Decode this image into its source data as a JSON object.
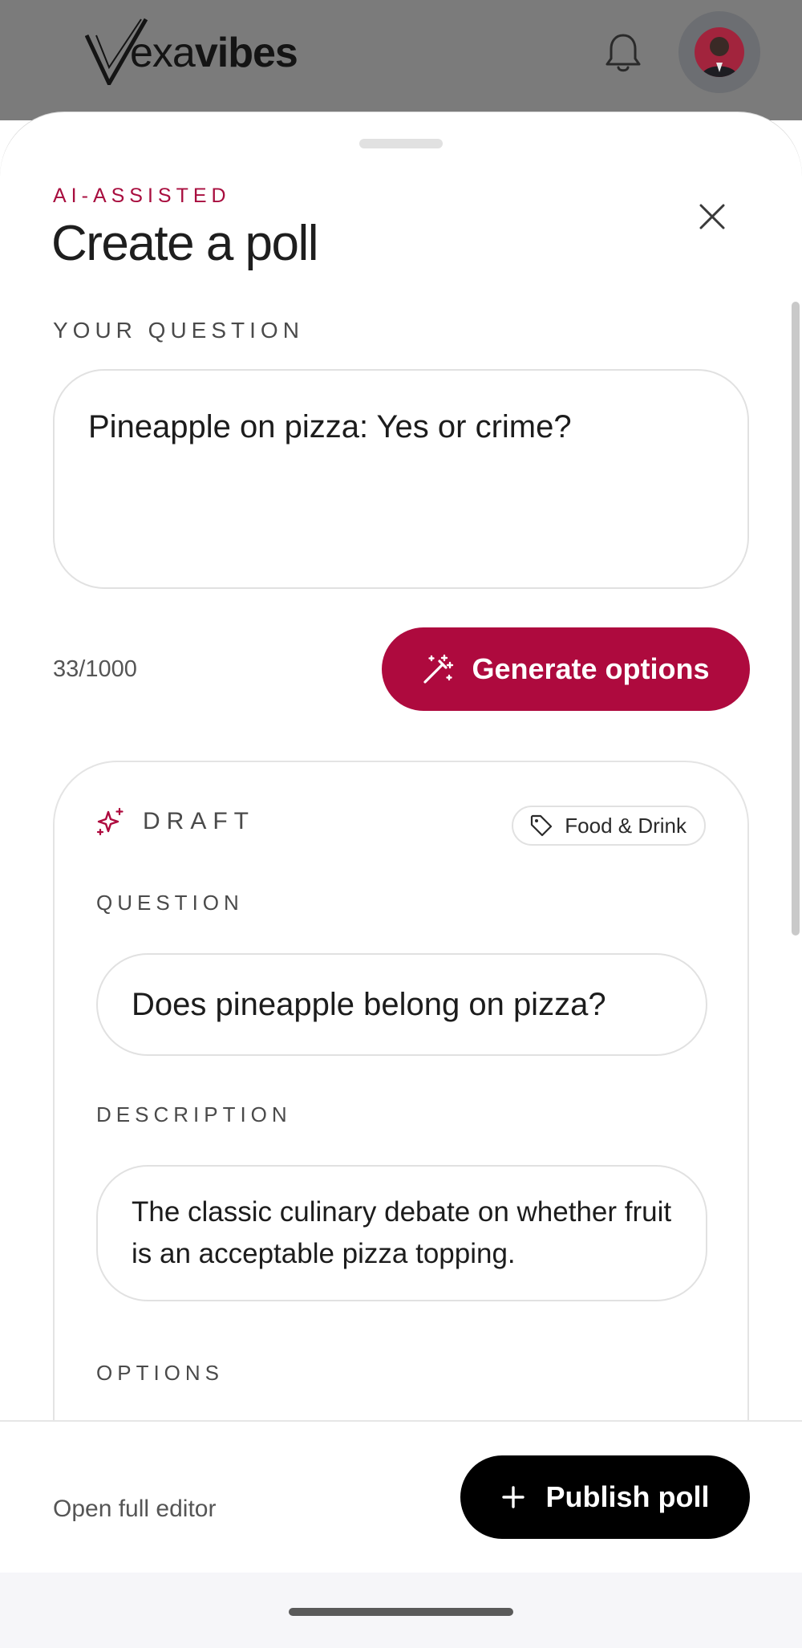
{
  "app": {
    "brand_prefix": "exa",
    "brand_suffix": "vibes",
    "icons": {
      "notifications": "bell-icon",
      "profile": "avatar"
    }
  },
  "sheet": {
    "eyebrow": "AI-ASSISTED",
    "title": "Create a poll",
    "close_icon": "close-icon"
  },
  "question_section": {
    "label": "YOUR QUESTION",
    "value": "Pineapple on pizza: Yes or crime?",
    "char_count": "33/1000"
  },
  "generate_button": {
    "label": "Generate options",
    "icon": "magic-wand-icon",
    "color": "#ae0a3e"
  },
  "draft": {
    "label": "DRAFT",
    "icon": "sparkles-icon",
    "tag": {
      "label": "Food & Drink",
      "icon": "tag-icon"
    },
    "question_label": "QUESTION",
    "question_value": "Does pineapple belong on pizza?",
    "description_label": "DESCRIPTION",
    "description_value": "The classic culinary debate on whether fruit is an acceptable pizza topping.",
    "options_label": "OPTIONS"
  },
  "footer": {
    "open_editor": "Open full editor",
    "publish_label": "Publish poll",
    "publish_icon": "plus-icon"
  },
  "colors": {
    "accent": "#ae0a3e",
    "primary_button": "#000000"
  }
}
